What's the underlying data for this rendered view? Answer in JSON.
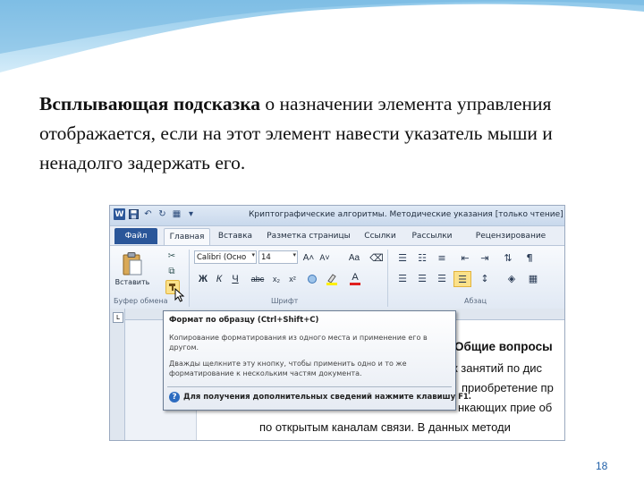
{
  "slide": {
    "heading_bold": "Всплывающая подсказка",
    "heading_rest": " о назначении элемента управления отображается, если на этот элемент навести указатель мыши и ненадолго задержать его.",
    "page_number": "18"
  },
  "window": {
    "title": "Криптографические алгоритмы. Методические указания [только чтение] [Ре",
    "app_icon": "W"
  },
  "tabs": [
    "Файл",
    "Главная",
    "Вставка",
    "Разметка страницы",
    "Ссылки",
    "Рассылки",
    "Рецензирование"
  ],
  "ribbon": {
    "paste_label": "Вставить",
    "clipboard_group": "Буфер обмена",
    "font_group": "Шрифт",
    "paragraph_group": "Абзац",
    "font_name": "Calibri (Осно",
    "font_size": "14",
    "grow_font": "A˄",
    "shrink_font": "A˅",
    "change_case": "Aa",
    "bold": "Ж",
    "italic": "К",
    "underline": "Ч",
    "strikethrough": "abc",
    "subscript": "x₂",
    "superscript": "x²",
    "font_color": "A"
  },
  "tooltip": {
    "title": "Формат по образцу (Ctrl+Shift+C)",
    "desc1": "Копирование форматирования из одного места и применение его в другом.",
    "desc2": "Дважды щелкните эту кнопку, чтобы применить одно и то же форматирование к нескольким частям документа.",
    "help": "Для получения дополнительных сведений нажмите клавишу F1."
  },
  "document": {
    "line1": "Общие вопросы",
    "line2": "к занятий по дис",
    "line3": "приобретение пр",
    "line4": "нкающих прие об",
    "line5": "по открытым каналам связи. В данных методи"
  },
  "colors": {
    "file_tab": "#2a5699",
    "highlight": "#fbe18a",
    "page_number": "#1f5fa8"
  }
}
